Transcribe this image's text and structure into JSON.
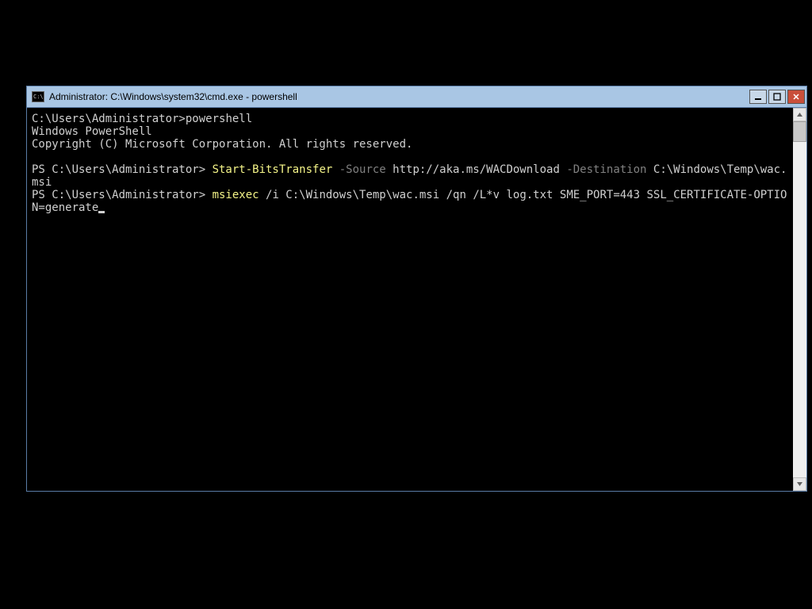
{
  "window": {
    "title": "Administrator: C:\\Windows\\system32\\cmd.exe - powershell"
  },
  "terminal": {
    "line1_prompt": "C:\\Users\\Administrator>",
    "line1_cmd": "powershell",
    "line2": "Windows PowerShell",
    "line3": "Copyright (C) Microsoft Corporation. All rights reserved.",
    "ps1_prompt": "PS C:\\Users\\Administrator> ",
    "ps1_cmd": "Start-BitsTransfer",
    "ps1_p1": " -Source",
    "ps1_v1": " http://aka.ms/WACDownload",
    "ps1_p2": " -Destination",
    "ps1_v2": " C:\\Windows\\Temp\\wac.msi",
    "ps2_prompt": "PS C:\\Users\\Administrator> ",
    "ps2_cmd": "msiexec",
    "ps2_args": " /i C:\\Windows\\Temp\\wac.msi /qn /L*v log.txt SME_PORT=443 SSL_CERTIFICATE-OPTION=generate"
  }
}
